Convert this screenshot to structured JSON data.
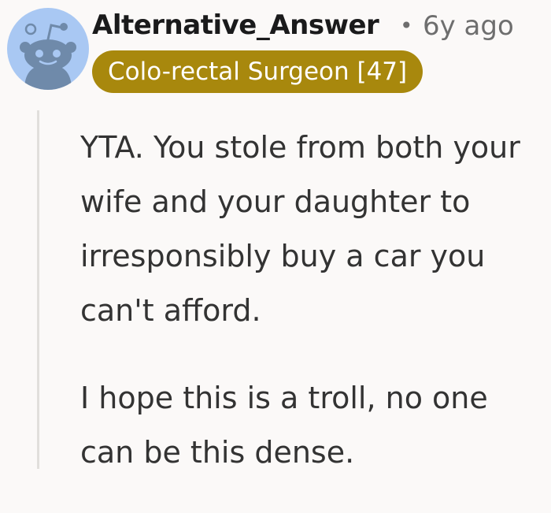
{
  "comment": {
    "author": "Alternative_Answer",
    "separator": "•",
    "age": "6y ago",
    "flair": "Colo-rectal Surgeon [47]",
    "paragraphs": [
      "YTA. You stole from both your wife and your daughter to irresponsibly buy a car you can't afford.",
      "I hope this is a troll, no one can be this dense."
    ]
  },
  "colors": {
    "avatar_background": "#a9c8f3",
    "flair_background": "#a8880d",
    "flair_text": "#ffffff",
    "meta_text": "#6e6e6e"
  },
  "icons": {
    "avatar": "reddit-snoo-avatar-icon"
  }
}
